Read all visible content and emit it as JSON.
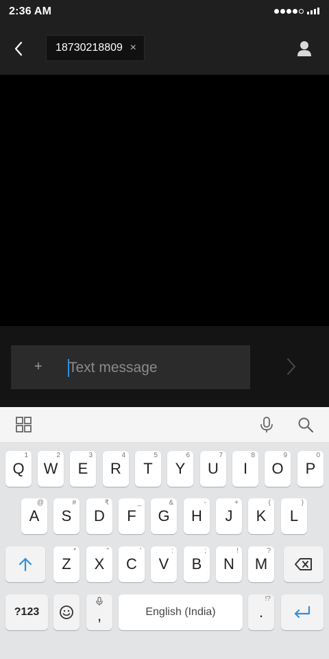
{
  "status_bar": {
    "time": "2:36 AM"
  },
  "header": {
    "recipient": "18730218809",
    "remove_symbol": "×"
  },
  "compose": {
    "add_symbol": "+",
    "placeholder": "Text message"
  },
  "keyboard": {
    "toolbar": [
      "grid-icon",
      "mic-icon",
      "search-icon"
    ],
    "row1": [
      {
        "key": "Q",
        "hint": "1"
      },
      {
        "key": "W",
        "hint": "2"
      },
      {
        "key": "E",
        "hint": "3"
      },
      {
        "key": "R",
        "hint": "4"
      },
      {
        "key": "T",
        "hint": "5"
      },
      {
        "key": "Y",
        "hint": "6"
      },
      {
        "key": "U",
        "hint": "7"
      },
      {
        "key": "I",
        "hint": "8"
      },
      {
        "key": "O",
        "hint": "9"
      },
      {
        "key": "P",
        "hint": "0"
      }
    ],
    "row2": [
      {
        "key": "A",
        "hint": "@"
      },
      {
        "key": "S",
        "hint": "#"
      },
      {
        "key": "D",
        "hint": "₹"
      },
      {
        "key": "F",
        "hint": "_"
      },
      {
        "key": "G",
        "hint": "&"
      },
      {
        "key": "H",
        "hint": "-"
      },
      {
        "key": "J",
        "hint": "+"
      },
      {
        "key": "K",
        "hint": "("
      },
      {
        "key": "L",
        "hint": ")"
      }
    ],
    "row3": [
      {
        "key": "Z",
        "hint": "*"
      },
      {
        "key": "X",
        "hint": "\""
      },
      {
        "key": "C",
        "hint": "'"
      },
      {
        "key": "V",
        "hint": ":"
      },
      {
        "key": "B",
        "hint": ";"
      },
      {
        "key": "N",
        "hint": "!"
      },
      {
        "key": "M",
        "hint": "?"
      }
    ],
    "symbols_label": "?123",
    "comma": ",",
    "period": ".",
    "period_hint": "!?",
    "space_label": "English (India)"
  },
  "colors": {
    "accent": "#2f8fdc",
    "header_bg": "#1f1f1f",
    "keyboard_bg": "#e3e4e6"
  }
}
